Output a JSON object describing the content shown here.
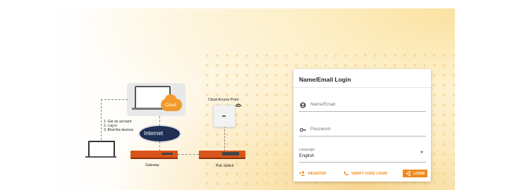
{
  "diagram": {
    "cloud_label": "Cloud",
    "internet_label": "Internet",
    "steps": [
      "1. Get an account",
      "2. Log in",
      "3. Bind the devices"
    ],
    "access_point_label": "Cloud Access Point",
    "gateway_label": "Gateway",
    "poe_switch_label": "PoE Switch"
  },
  "login": {
    "title": "Name/Email Login",
    "name_placeholder": "Name/Email",
    "password_placeholder": "Password",
    "language_caption": "Language",
    "language_value": "English",
    "register_label": "REGISTER",
    "verify_label": "VERIFY CODE LOGIN",
    "login_label": "LOGIN"
  },
  "colors": {
    "accent": "#f08a1e",
    "internet_bg": "#1f2f55"
  }
}
